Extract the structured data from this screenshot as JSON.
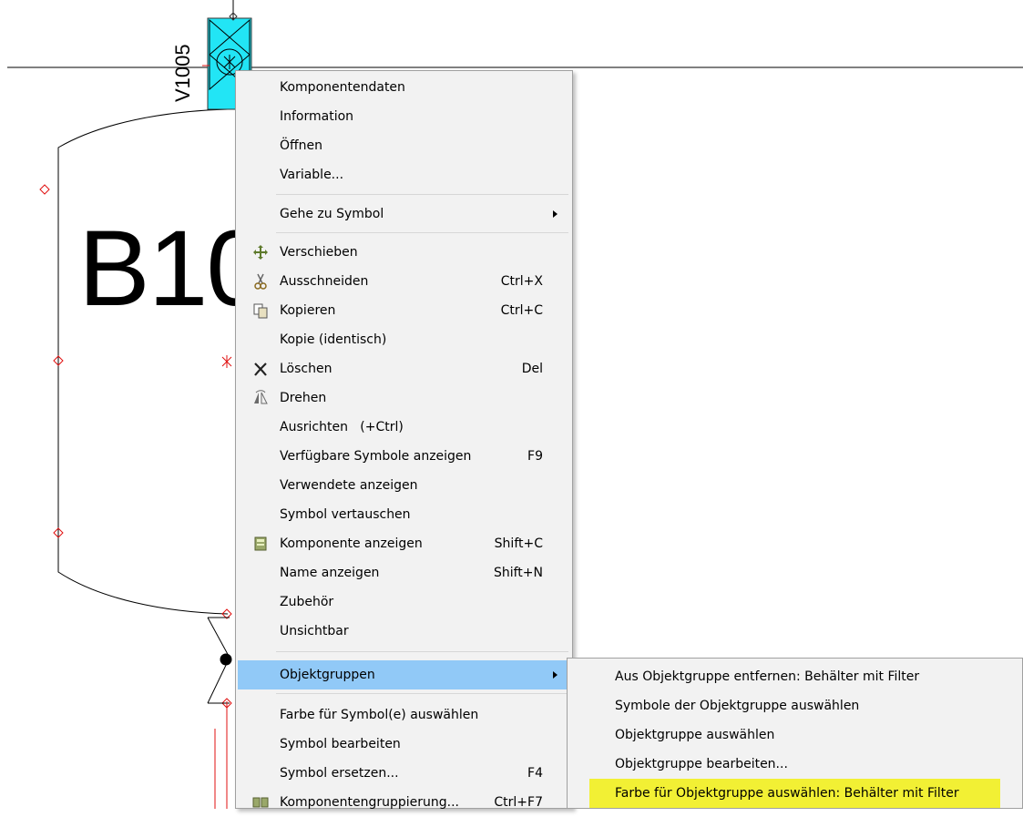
{
  "drawing": {
    "big_label": "B10",
    "tag_label": "V1005"
  },
  "context_menu": {
    "items": [
      {
        "label": "Komponentendaten",
        "shortcut": ""
      },
      {
        "label": "Information",
        "shortcut": ""
      },
      {
        "label": "Öffnen",
        "shortcut": ""
      },
      {
        "label": "Variable...",
        "shortcut": ""
      },
      {
        "label": "Gehe zu Symbol",
        "shortcut": ""
      },
      {
        "label": "Verschieben",
        "shortcut": "",
        "icon": "move-icon"
      },
      {
        "label": "Ausschneiden",
        "shortcut": "Ctrl+X",
        "icon": "scissors-icon"
      },
      {
        "label": "Kopieren",
        "shortcut": "Ctrl+C",
        "icon": "copy-icon"
      },
      {
        "label": "Kopie (identisch)",
        "shortcut": ""
      },
      {
        "label": "Löschen",
        "shortcut": "Del",
        "icon": "delete-x-icon"
      },
      {
        "label": "Drehen",
        "shortcut": "",
        "icon": "rotate-icon"
      },
      {
        "label": "Ausrichten   (+Ctrl)",
        "shortcut": ""
      },
      {
        "label": "Verfügbare Symbole anzeigen",
        "shortcut": "F9"
      },
      {
        "label": "Verwendete anzeigen",
        "shortcut": ""
      },
      {
        "label": "Symbol vertauschen",
        "shortcut": ""
      },
      {
        "label": "Komponente anzeigen",
        "shortcut": "Shift+C",
        "icon": "component-icon"
      },
      {
        "label": "Name anzeigen",
        "shortcut": "Shift+N"
      },
      {
        "label": "Zubehör",
        "shortcut": ""
      },
      {
        "label": "Unsichtbar",
        "shortcut": ""
      },
      {
        "label": "Objektgruppen",
        "shortcut": "",
        "highlighted": true,
        "has_submenu": true
      },
      {
        "label": "Farbe für Symbol(e) auswählen",
        "shortcut": ""
      },
      {
        "label": "Symbol bearbeiten",
        "shortcut": ""
      },
      {
        "label": "Symbol ersetzen...",
        "shortcut": "F4"
      },
      {
        "label": "Komponentengruppierung...",
        "shortcut": "Ctrl+F7",
        "icon": "grouping-icon"
      }
    ]
  },
  "submenu": {
    "items": [
      {
        "label": "Aus Objektgruppe entfernen: Behälter mit Filter"
      },
      {
        "label": "Symbole der Objektgruppe auswählen"
      },
      {
        "label": "Objektgruppe auswählen"
      },
      {
        "label": "Objektgruppe bearbeiten..."
      },
      {
        "label": "Farbe für Objektgruppe auswählen: Behälter mit Filter",
        "highlighted": true
      }
    ]
  },
  "colors": {
    "menu_bg": "#f2f2f2",
    "menu_highlight": "#91c9f7",
    "submenu_highlight": "#f2f034",
    "selection_fill": "#22e5f5",
    "connector_red": "#e01010"
  }
}
